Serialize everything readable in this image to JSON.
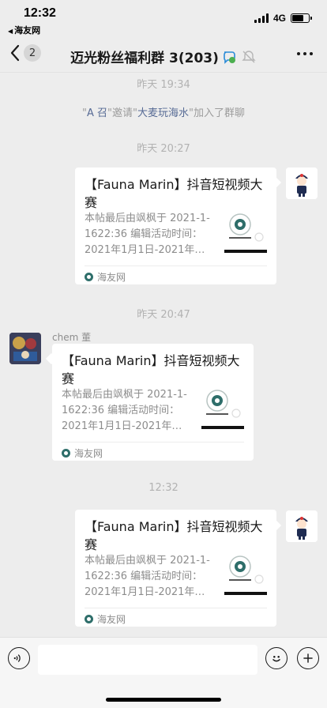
{
  "status_bar": {
    "time": "12:32",
    "back_app": "海友网",
    "network": "4G",
    "battery_percent": 70
  },
  "nav": {
    "back_badge": "2",
    "title": "迈光粉丝福利群 3(203)"
  },
  "chat": {
    "ts1": "昨天 19:34",
    "system": {
      "q1": "\"",
      "inviter": "A 召",
      "mid": "\"邀请\"",
      "invitee": "大麦玩海水",
      "end": "\"加入了群聊"
    },
    "ts2": "昨天 20:27",
    "ts3": "昨天 20:47",
    "ts4": "12:32",
    "sender_chem": "chem 董",
    "link_card": {
      "title": "【Fauna Marin】抖音短视频大赛",
      "desc": "本帖最后由飒枫于 2021-1-1622:36 编辑活动时间：2021年1月1日-2021年…",
      "source": "海友网"
    }
  }
}
